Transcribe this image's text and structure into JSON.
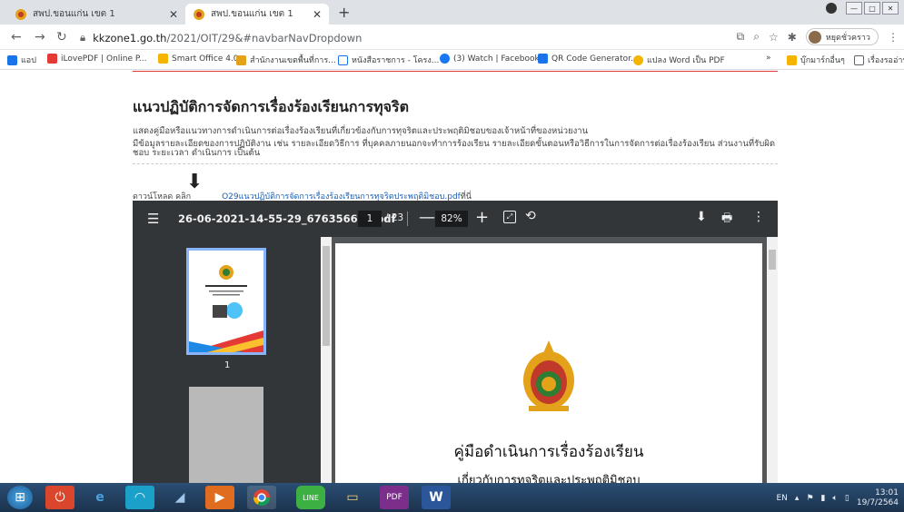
{
  "browser": {
    "tabs": [
      {
        "title": "สพป.ขอนแก่น เขต 1",
        "active": false
      },
      {
        "title": "สพป.ขอนแก่น เขต 1",
        "active": true
      }
    ],
    "url_host": "kkzone1.go.th",
    "url_path": "/2021/OIT/29&#navbarNavDropdown",
    "profile_name": "หยุดชั่วคราว",
    "bookmarks": [
      "แอป",
      "iLovePDF | Online P...",
      "Smart Office 4.0",
      "สำนักงานเขตพื้นที่การ...",
      "หนังสือราชการ - โครง...",
      "(3) Watch | Facebook",
      "QR Code Generator...",
      "แปลง Word เป็น PDF",
      "»",
      "บุ๊กมาร์กอื่นๆ",
      "เรื่องรออ่าน"
    ]
  },
  "page": {
    "heading": "แนวปฏิบัติการจัดการเรื่องร้องเรียนการทุจริต",
    "desc1": "แสดงคู่มือหรือแนวทางการดำเนินการต่อเรื่องร้องเรียนที่เกี่ยวข้องกับการทุจริตและประพฤติมิชอบของเจ้าหน้าที่ของหน่วยงาน",
    "desc2": "มีข้อมูลรายละเอียดของการปฏิบัติงาน เช่น รายละเอียดวิธีการ ที่บุคคลภายนอกจะทำการร้องเรียน รายละเอียดขั้นตอนหรือวิธีการในการจัดการต่อเรื่องร้องเรียน ส่วนงานที่รับผิดชอบ ระยะเวลา ดำเนินการ เป็นต้น",
    "download_prefix": "ดาวน์โหลด คลิก",
    "download_link": "O29แนวปฏิบัติการจัดการเรื่องร้องเรียนการทุจริตประพฤติมิชอบ.pdf",
    "download_suffix": "ที่นี่"
  },
  "pdf": {
    "filename": "26-06-2021-14-55-29_676356666.pdf",
    "current_page": "1",
    "total_pages": "/ 23",
    "zoom": "82%",
    "thumb_label": "1",
    "doc_title": "คู่มือดำเนินการเรื่องร้องเรียน",
    "doc_subtitle": "เกี่ยวกับการทุจริตและประพฤติมิชอบ"
  },
  "tray": {
    "lang": "EN",
    "time": "13:01",
    "date": "19/7/2564"
  }
}
